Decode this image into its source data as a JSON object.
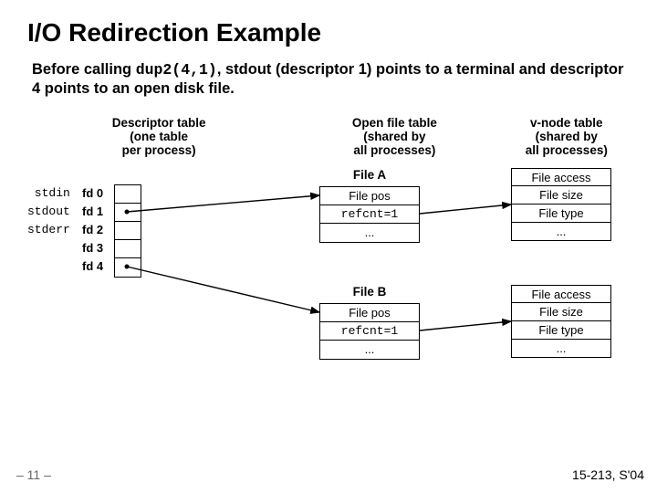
{
  "title": "I/O Redirection Example",
  "intro_pre": "Before calling ",
  "intro_code": "dup2(4,1)",
  "intro_post": ", stdout (descriptor 1) points to a terminal and descriptor 4 points to an open disk file.",
  "headers": {
    "desc": "Descriptor table\n(one table\nper process)",
    "open": "Open file table\n(shared by\nall processes)",
    "vnode": "v-node table\n(shared by\nall processes)"
  },
  "fd": {
    "stdin": "stdin",
    "stdout": "stdout",
    "stderr": "stderr",
    "n0": "fd 0",
    "n1": "fd 1",
    "n2": "fd 2",
    "n3": "fd 3",
    "n4": "fd 4"
  },
  "fileA": {
    "title": "File A",
    "pos": "File pos",
    "ref": "refcnt=1",
    "dots": "..."
  },
  "fileB": {
    "title": "File B",
    "pos": "File pos",
    "ref": "refcnt=1",
    "dots": "..."
  },
  "vnodeA": {
    "access": "File access",
    "size": "File size",
    "type": "File type",
    "dots": "..."
  },
  "vnodeB": {
    "access": "File access",
    "size": "File size",
    "type": "File type",
    "dots": "..."
  },
  "slidenum": "– 11 –",
  "course": "15-213, S'04"
}
